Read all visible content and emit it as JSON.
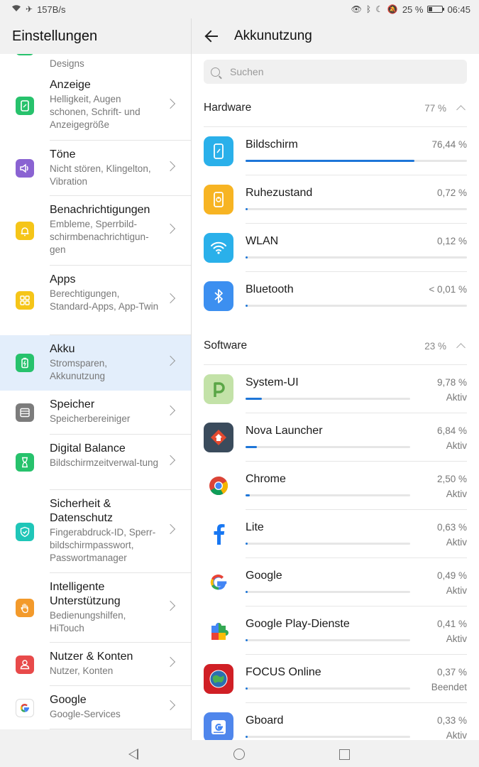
{
  "status": {
    "speed": "157B/s",
    "battery": "25 %",
    "time": "06:45"
  },
  "left": {
    "title": "Einstellungen",
    "partial_sub": "Designs",
    "items": [
      {
        "title": "Anzeige",
        "sub": "Helligkeit, Augen schonen, Schrift- und Anzeigegröße",
        "icon": "display-icon",
        "color": "#27c26c"
      },
      {
        "title": "Töne",
        "sub": "Nicht stören, Klingelton, Vibration",
        "icon": "speaker-icon",
        "color": "#8a63d2"
      },
      {
        "title": "Benachrichtigungen",
        "sub": "Embleme, Sperrbild-schirmbenachrichtigun-gen",
        "icon": "bell-icon",
        "color": "#f5c518"
      },
      {
        "title": "Apps",
        "sub": "Berechtigungen, Standard-Apps, App-Twin",
        "icon": "apps-icon",
        "color": "#f5c518"
      },
      {
        "title": "Akku",
        "sub": "Stromsparen, Akkunutzung",
        "icon": "battery-icon",
        "color": "#27c26c"
      },
      {
        "title": "Speicher",
        "sub": "Speicherbereiniger",
        "icon": "storage-icon",
        "color": "#7c7c7c"
      },
      {
        "title": "Digital Balance",
        "sub": "Bildschirmzeitverwal-tung",
        "icon": "hourglass-icon",
        "color": "#27c26c"
      },
      {
        "title": "Sicherheit & Datenschutz",
        "sub": "Fingerabdruck-ID, Sperr-bildschirmpasswort, Passwortmanager",
        "icon": "shield-icon",
        "color": "#1fc6b8"
      },
      {
        "title": "Intelligente Unterstützung",
        "sub": "Bedienungshilfen, HiTouch",
        "icon": "hand-icon",
        "color": "#f39a2b"
      },
      {
        "title": "Nutzer & Konten",
        "sub": "Nutzer, Konten",
        "icon": "user-icon",
        "color": "#e84a4a"
      },
      {
        "title": "Google",
        "sub": "Google-Services",
        "icon": "google-icon",
        "color": "#ffffff"
      }
    ]
  },
  "right": {
    "title": "Akkunutzung",
    "search_placeholder": "Suchen",
    "hardware": {
      "label": "Hardware",
      "value": "77 %",
      "rows": [
        {
          "name": "Bildschirm",
          "pct": "76,44 %",
          "level": 76.44,
          "icon": "phone-screen-icon",
          "color": "#2ab0ea"
        },
        {
          "name": "Ruhezustand",
          "pct": "0,72 %",
          "level": 0.72,
          "icon": "standby-icon",
          "color": "#f7b423"
        },
        {
          "name": "WLAN",
          "pct": "0,12 %",
          "level": 0.12,
          "icon": "wifi-icon",
          "color": "#2ab0ea"
        },
        {
          "name": "Bluetooth",
          "pct": "< 0,01 %",
          "level": 0.01,
          "icon": "bluetooth-icon",
          "color": "#3c8ff0"
        }
      ]
    },
    "software": {
      "label": "Software",
      "value": "23 %",
      "rows": [
        {
          "name": "System-UI",
          "pct": "9,78 %",
          "state": "Aktiv",
          "level": 9.78,
          "icon": "android-p-icon"
        },
        {
          "name": "Nova Launcher",
          "pct": "6,84 %",
          "state": "Aktiv",
          "level": 6.84,
          "icon": "nova-launcher-icon"
        },
        {
          "name": "Chrome",
          "pct": "2,50 %",
          "state": "Aktiv",
          "level": 2.5,
          "icon": "chrome-icon"
        },
        {
          "name": "Lite",
          "pct": "0,63 %",
          "state": "Aktiv",
          "level": 0.63,
          "icon": "facebook-icon"
        },
        {
          "name": "Google",
          "pct": "0,49 %",
          "state": "Aktiv",
          "level": 0.49,
          "icon": "google-icon"
        },
        {
          "name": "Google Play-Dienste",
          "pct": "0,41 %",
          "state": "Aktiv",
          "level": 0.41,
          "icon": "play-services-icon"
        },
        {
          "name": "FOCUS Online",
          "pct": "0,37 %",
          "state": "Beendet",
          "level": 0.37,
          "icon": "focus-online-icon"
        },
        {
          "name": "Gboard",
          "pct": "0,33 %",
          "state": "Aktiv",
          "level": 0.33,
          "icon": "gboard-icon"
        }
      ]
    }
  }
}
